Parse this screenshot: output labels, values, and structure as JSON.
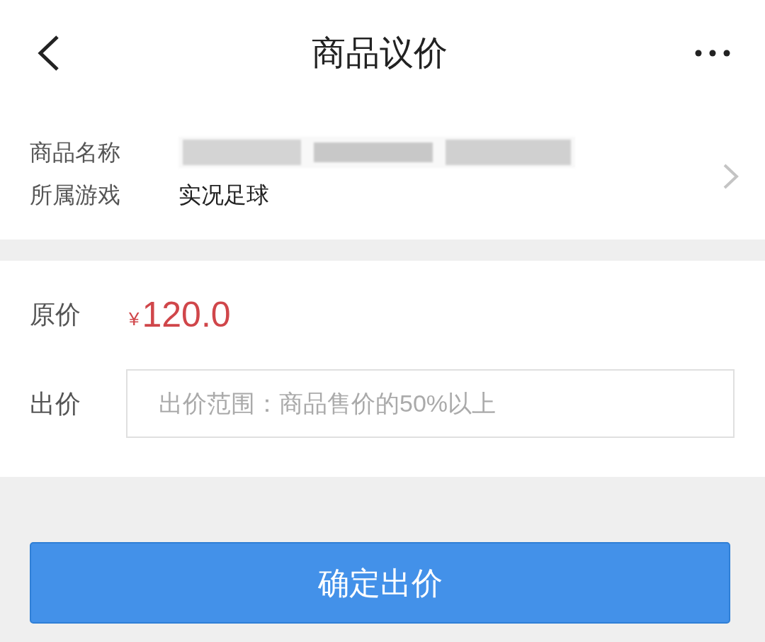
{
  "header": {
    "title": "商品议价"
  },
  "product": {
    "fields": [
      {
        "label": "商品名称",
        "kind": "blurred"
      },
      {
        "label": "所属游戏",
        "kind": "text",
        "value": "实况足球"
      }
    ]
  },
  "offer": {
    "original_price": {
      "label": "原价",
      "currency": "¥",
      "amount": "120.0"
    },
    "bid": {
      "label": "出价",
      "placeholder": "出价范围：商品售价的50%以上"
    }
  },
  "submit": {
    "label": "确定出价"
  }
}
